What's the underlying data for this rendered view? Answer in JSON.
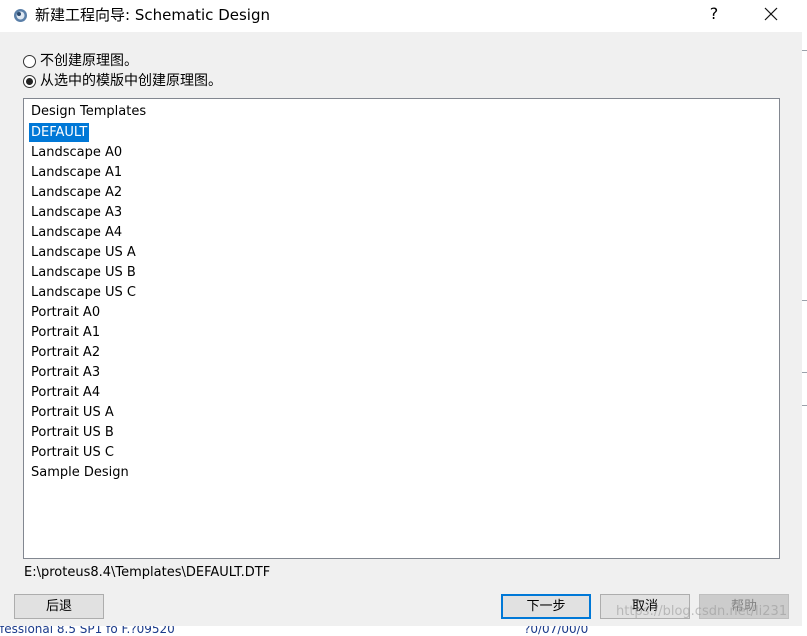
{
  "window": {
    "title": "新建工程向导: Schematic Design",
    "help_label": "?",
    "icons": {
      "app": "proteus-app-icon",
      "close": "close-icon"
    }
  },
  "options": [
    {
      "label": "不创建原理图。",
      "checked": false
    },
    {
      "label": "从选中的模版中创建原理图。",
      "checked": true
    }
  ],
  "templates": {
    "header": "Design Templates",
    "items": [
      "DEFAULT",
      "Landscape A0",
      "Landscape A1",
      "Landscape A2",
      "Landscape A3",
      "Landscape A4",
      "Landscape US A",
      "Landscape US B",
      "Landscape US C",
      "Portrait A0",
      "Portrait A1",
      "Portrait A2",
      "Portrait A3",
      "Portrait A4",
      "Portrait US A",
      "Portrait US B",
      "Portrait US C",
      "Sample Design"
    ],
    "selected": "DEFAULT"
  },
  "selected_path": "E:\\proteus8.4\\Templates\\DEFAULT.DTF",
  "buttons": {
    "back": "后退",
    "next": "下一步",
    "cancel": "取消",
    "help": "帮助"
  },
  "background": {
    "left_fragment": "fessional 8.5 SP1 fo F.?09520",
    "right_fragment": "?0/07/00/0"
  },
  "watermark": "https://blog.csdn.net/li231",
  "colors": {
    "selection": "#0078d7",
    "dialog_bg": "#f0f0f0"
  }
}
